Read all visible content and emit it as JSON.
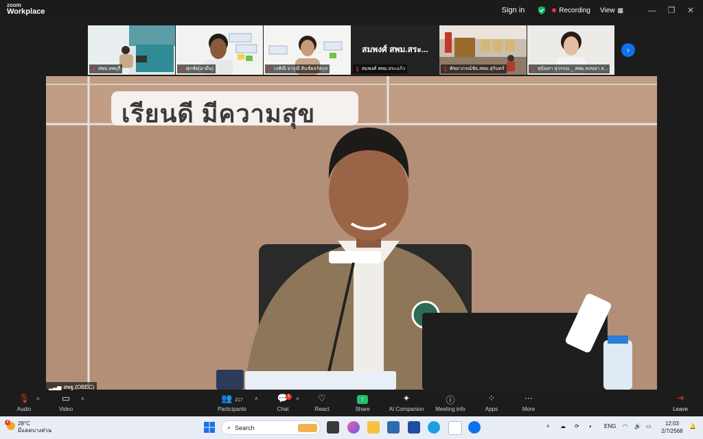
{
  "app": {
    "brand_top": "zoom",
    "brand_bottom": "Workplace"
  },
  "titlebar": {
    "sign_in": "Sign in",
    "recording": "Recording",
    "view": "View"
  },
  "gallery": {
    "tiles": [
      {
        "name": "สพม.ลพบุรี"
      },
      {
        "name": "ศุภชัย(อามีน)"
      },
      {
        "name": "เกศิณี จารุณี สินชัยจรัสกุล"
      },
      {
        "name": "สมพงศ์ สพม.สระแก้ว",
        "display": "สมพงศ์ สพม.สระ..."
      },
      {
        "name": "พัชยาภรณ์ชัย.สพม.สุรินทร์"
      },
      {
        "name": "สุนันทา สุวรรณ _ สพม.สงขลา ส..."
      }
    ]
  },
  "main_video": {
    "sign_text": "เรียนดี มีความสุข",
    "name_label": "สพฐ.(OBEC)"
  },
  "toolbar": {
    "audio": "Audio",
    "video": "Video",
    "participants": "Participants",
    "participants_count": "217",
    "chat": "Chat",
    "chat_badge": "1",
    "react": "React",
    "share": "Share",
    "ai_companion": "AI Companion",
    "meeting_info": "Meeting info",
    "apps": "Apps",
    "more": "More",
    "leave": "Leave"
  },
  "taskbar": {
    "weather_temp": "28°C",
    "weather_desc": "มีแดดบางส่วน",
    "weather_badge": "4",
    "search_placeholder": "Search",
    "lang": "ENG",
    "time": "12:03",
    "date": "2/7/2568"
  },
  "colors": {
    "accent": "#0e72ed",
    "record": "#e8332b",
    "share": "#21c26b",
    "shield": "#17b26a"
  }
}
